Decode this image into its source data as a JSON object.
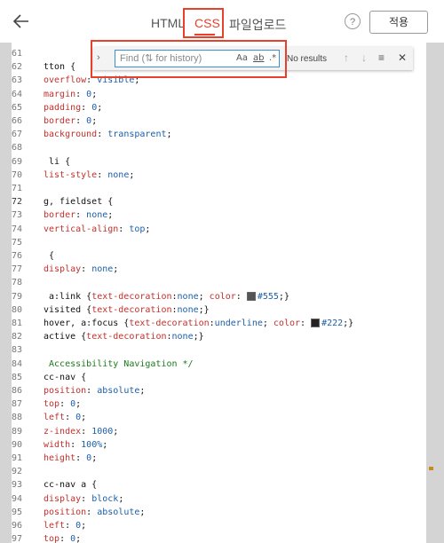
{
  "header": {
    "back_icon": "arrow-left-icon",
    "tabs": [
      {
        "label": "HTML",
        "active": false
      },
      {
        "label": "CSS",
        "active": true
      },
      {
        "label": "파일업로드",
        "active": false
      }
    ],
    "help_label": "?",
    "apply_label": "적용",
    "accent_color": "#e8412b"
  },
  "find": {
    "toggle_icon": "chevron-right-icon",
    "placeholder": "Find (⇅ for history)",
    "value": "",
    "match_case_label": "Aa",
    "whole_word_label": "ab",
    "regex_label": ".*",
    "status": "No results",
    "prev_icon": "arrow-up-icon",
    "next_icon": "arrow-down-icon",
    "selection_icon": "find-in-selection-icon",
    "close_icon": "close-icon"
  },
  "editor": {
    "active_line": "72",
    "lines": [
      {
        "n": "61",
        "t": ""
      },
      {
        "n": "62",
        "t": "tton {"
      },
      {
        "n": "63",
        "t": "overflow: visible;"
      },
      {
        "n": "64",
        "t": "margin: 0;"
      },
      {
        "n": "65",
        "t": "padding: 0;"
      },
      {
        "n": "66",
        "t": "border: 0;"
      },
      {
        "n": "67",
        "t": "background: transparent;"
      },
      {
        "n": "68",
        "t": ""
      },
      {
        "n": "69",
        "t": " li {"
      },
      {
        "n": "70",
        "t": "list-style: none;"
      },
      {
        "n": "71",
        "t": ""
      },
      {
        "n": "72",
        "t": "g, fieldset {"
      },
      {
        "n": "73",
        "t": "border: none;"
      },
      {
        "n": "74",
        "t": "vertical-align: top;"
      },
      {
        "n": "75",
        "t": ""
      },
      {
        "n": "76",
        "t": " {"
      },
      {
        "n": "77",
        "t": "display: none;"
      },
      {
        "n": "78",
        "t": ""
      },
      {
        "n": "79",
        "t": " a:link {text-decoration:none; color: #555;}"
      },
      {
        "n": "80",
        "t": "visited {text-decoration:none;}"
      },
      {
        "n": "81",
        "t": "hover, a:focus {text-decoration:underline; color: #222;}"
      },
      {
        "n": "82",
        "t": "active {text-decoration:none;}"
      },
      {
        "n": "83",
        "t": ""
      },
      {
        "n": "84",
        "t": " Accessibility Navigation */"
      },
      {
        "n": "85",
        "t": "cc-nav {"
      },
      {
        "n": "86",
        "t": "position: absolute;"
      },
      {
        "n": "87",
        "t": "top: 0;"
      },
      {
        "n": "88",
        "t": "left: 0;"
      },
      {
        "n": "89",
        "t": "z-index: 1000;"
      },
      {
        "n": "90",
        "t": "width: 100%;"
      },
      {
        "n": "91",
        "t": "height: 0;"
      },
      {
        "n": "92",
        "t": ""
      },
      {
        "n": "93",
        "t": "cc-nav a {"
      },
      {
        "n": "94",
        "t": "display: block;"
      },
      {
        "n": "95",
        "t": "position: absolute;"
      },
      {
        "n": "96",
        "t": "left: 0;"
      },
      {
        "n": "97",
        "t": "top: 0;"
      }
    ],
    "swatch_colors": {
      "79": "#555555",
      "81": "#222222"
    }
  }
}
